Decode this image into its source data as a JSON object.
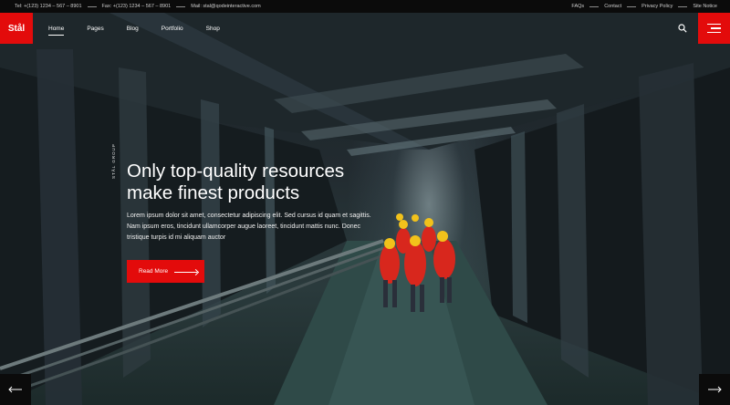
{
  "topbar": {
    "tel": "Tel: +(123) 1234 – 567 – 8901",
    "fax": "Fax: +(123) 1234 – 567 – 8901",
    "mail": "Mail: stal@qodeinteractive.com",
    "links": [
      "FAQs",
      "Contact",
      "Privacy Policy",
      "Site Notice"
    ]
  },
  "header": {
    "logo": "Stål",
    "nav": [
      "Home",
      "Pages",
      "Blog",
      "Portfolio",
      "Shop"
    ],
    "search_icon": "search-icon",
    "menu_icon": "hamburger-icon"
  },
  "slide": {
    "vertical_label": "STÅL GROUP",
    "title_line1": "Only top-quality resources",
    "title_line2": "make finest products",
    "description": "Lorem ipsum dolor sit amet, consectetur adipiscing elit. Sed cursus id quam et sagittis. Nam ipsum eros, tincidunt ullamcorper augue laoreet, tincidunt mattis nunc. Donec tristique turpis id mi aliquam auctor",
    "cta_label": "Read More",
    "prev_icon": "arrow-left-icon",
    "next_icon": "arrow-right-icon"
  },
  "colors": {
    "accent": "#e30b0b",
    "topbar_bg": "#0b0b0b",
    "text": "#ffffff"
  }
}
